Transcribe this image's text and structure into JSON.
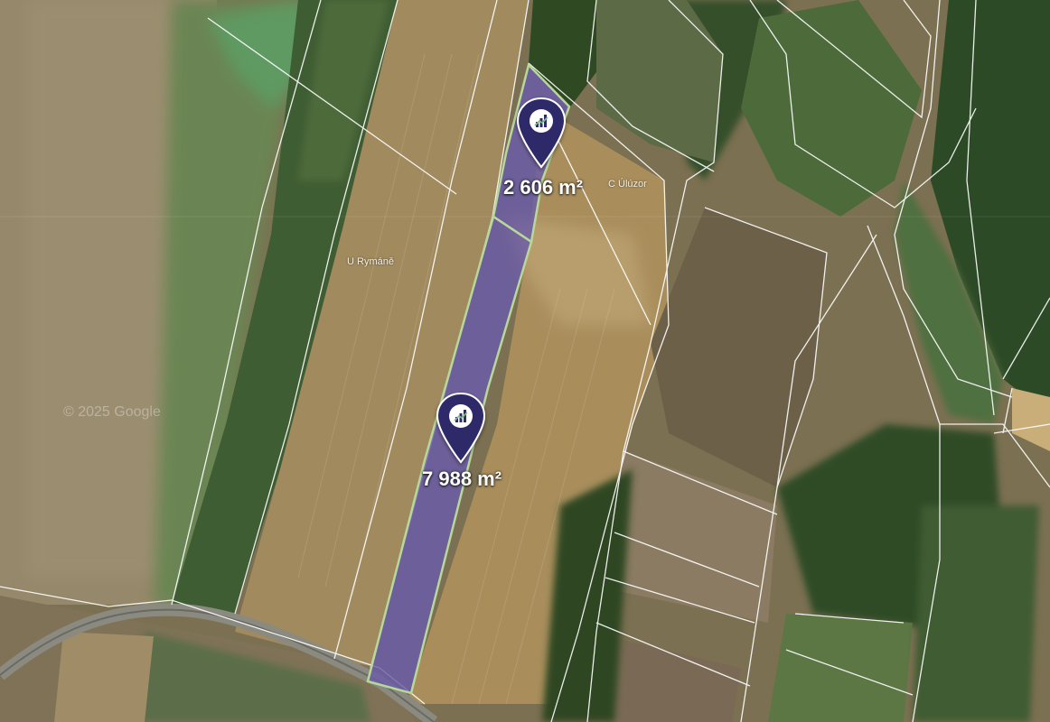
{
  "map": {
    "type": "satellite-cadastral",
    "overlay_color": "#6a5ba8",
    "pin_color": "#2f2b6b",
    "boundary_color": "#ffffff"
  },
  "parcels": [
    {
      "id": "parcel-north",
      "area_label": "2 606 m²",
      "icon": "chart-bars-icon"
    },
    {
      "id": "parcel-south",
      "area_label": "7 988 m²",
      "icon": "chart-bars-icon"
    }
  ],
  "place_labels": {
    "u_rymane": "U Rymáně",
    "c_uzor": "C Úlúzor"
  },
  "watermark": "© 2025 Google"
}
